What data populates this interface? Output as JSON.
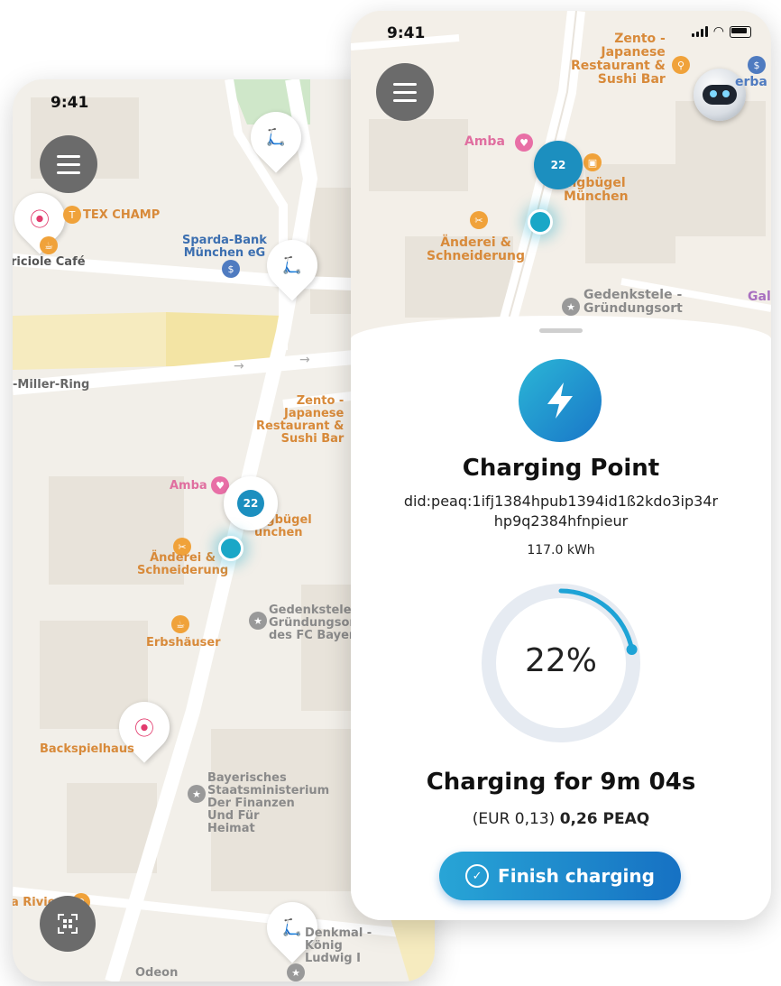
{
  "back_phone": {
    "time": "9:41",
    "map_labels": {
      "tex_champ": "TEX CHAMP",
      "sparda": "Sparda-Bank\nMünchen eG",
      "triciole": "riciole Café",
      "miller_ring": "-Miller-Ring",
      "zento": "Zento -\nJapanese\nRestaurant &\nSushi Bar",
      "amba": "Amba",
      "steigbugel": "eigbügel\nünchen",
      "anderei": "Änderei &\nSchneiderung",
      "gedenkstele": "Gedenkstele -\nGründungsort\ndes FC Bayern",
      "erbshauser": "Erbshäuser",
      "backspielhaus": "Backspielhaus",
      "bayerisches": "Bayerisches\nStaatsministerium\nDer Finanzen\nUnd Für\nHeimat",
      "riviera": "a Riviera",
      "denkmal": "Denkmal -\nKönig\nLudwig I",
      "odeon": "Odeon"
    },
    "charge_pin_value": "22"
  },
  "front_phone": {
    "time": "9:41",
    "map_labels": {
      "zento": "Zento -\nJapanese\nRestaurant &\nSushi Bar",
      "amba": "Amba",
      "steigbugel": "eigbügel\nMünchen",
      "anderei": "Änderei &\nSchneiderung",
      "gedenkstele": "Gedenkstele -\nGründungsort",
      "gal": "Gal",
      "erba": "erba"
    },
    "charge_pin_value": "22"
  },
  "sheet": {
    "title": "Charging Point",
    "did_line1": "did:peaq:1ifj1384hpub1394id1ß2kdo3ip34r",
    "did_line2": "hp9q2384hfnpieur",
    "energy": "117.0 kWh",
    "progress_percent": 22,
    "progress_label": "22%",
    "duration": "Charging for 9m 04s",
    "cost_fiat": "(EUR 0,13)",
    "cost_token": "0,26 PEAQ",
    "finish_button": "Finish charging"
  },
  "colors": {
    "accent": "#1c8fbf",
    "ring_track": "#e6ebf2",
    "ring_fill": "#1ea3d6"
  }
}
